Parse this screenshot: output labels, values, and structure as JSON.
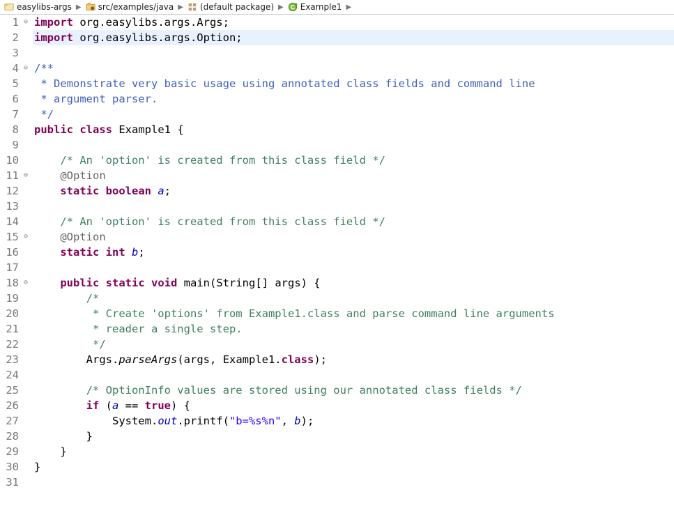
{
  "breadcrumb": {
    "project": "easylibs-args",
    "source_folder": "src/examples/java",
    "package": "(default package)",
    "class": "Example1"
  },
  "code": {
    "lines": [
      {
        "n": 1,
        "fold": "-",
        "tokens": [
          [
            "kw",
            "import"
          ],
          [
            "plain",
            " org.easylibs.args.Args;"
          ]
        ]
      },
      {
        "n": 2,
        "fold": "",
        "hl": true,
        "tokens": [
          [
            "kw",
            "import"
          ],
          [
            "plain",
            " org.easylibs.args.Option;"
          ]
        ]
      },
      {
        "n": 3,
        "fold": "",
        "tokens": []
      },
      {
        "n": 4,
        "fold": "-",
        "tokens": [
          [
            "javadoc",
            "/**"
          ]
        ]
      },
      {
        "n": 5,
        "fold": "",
        "tokens": [
          [
            "javadoc",
            " * Demonstrate very basic usage using annotated class fields and command line"
          ]
        ]
      },
      {
        "n": 6,
        "fold": "",
        "tokens": [
          [
            "javadoc",
            " * argument parser."
          ]
        ]
      },
      {
        "n": 7,
        "fold": "",
        "tokens": [
          [
            "javadoc",
            " */"
          ]
        ]
      },
      {
        "n": 8,
        "fold": "",
        "tokens": [
          [
            "kw",
            "public"
          ],
          [
            "plain",
            " "
          ],
          [
            "kw",
            "class"
          ],
          [
            "plain",
            " Example1 {"
          ]
        ]
      },
      {
        "n": 9,
        "fold": "",
        "tokens": []
      },
      {
        "n": 10,
        "fold": "",
        "tokens": [
          [
            "plain",
            "    "
          ],
          [
            "comment",
            "/* An 'option' is created from this class field */"
          ]
        ]
      },
      {
        "n": 11,
        "fold": "-",
        "tokens": [
          [
            "plain",
            "    "
          ],
          [
            "ann",
            "@Option"
          ]
        ]
      },
      {
        "n": 12,
        "fold": "",
        "tokens": [
          [
            "plain",
            "    "
          ],
          [
            "kw",
            "static"
          ],
          [
            "plain",
            " "
          ],
          [
            "kw",
            "boolean"
          ],
          [
            "plain",
            " "
          ],
          [
            "field",
            "a"
          ],
          [
            "plain",
            ";"
          ]
        ]
      },
      {
        "n": 13,
        "fold": "",
        "tokens": []
      },
      {
        "n": 14,
        "fold": "",
        "tokens": [
          [
            "plain",
            "    "
          ],
          [
            "comment",
            "/* An 'option' is created from this class field */"
          ]
        ]
      },
      {
        "n": 15,
        "fold": "-",
        "tokens": [
          [
            "plain",
            "    "
          ],
          [
            "ann",
            "@Option"
          ]
        ]
      },
      {
        "n": 16,
        "fold": "",
        "tokens": [
          [
            "plain",
            "    "
          ],
          [
            "kw",
            "static"
          ],
          [
            "plain",
            " "
          ],
          [
            "kw",
            "int"
          ],
          [
            "plain",
            " "
          ],
          [
            "field",
            "b"
          ],
          [
            "plain",
            ";"
          ]
        ]
      },
      {
        "n": 17,
        "fold": "",
        "tokens": []
      },
      {
        "n": 18,
        "fold": "-",
        "tokens": [
          [
            "plain",
            "    "
          ],
          [
            "kw",
            "public"
          ],
          [
            "plain",
            " "
          ],
          [
            "kw",
            "static"
          ],
          [
            "plain",
            " "
          ],
          [
            "kw",
            "void"
          ],
          [
            "plain",
            " main(String[] args) {"
          ]
        ]
      },
      {
        "n": 19,
        "fold": "",
        "tokens": [
          [
            "plain",
            "        "
          ],
          [
            "comment",
            "/*"
          ]
        ]
      },
      {
        "n": 20,
        "fold": "",
        "tokens": [
          [
            "plain",
            "        "
          ],
          [
            "comment",
            " * Create 'options' from Example1.class and parse command line arguments"
          ]
        ]
      },
      {
        "n": 21,
        "fold": "",
        "tokens": [
          [
            "plain",
            "        "
          ],
          [
            "comment",
            " * reader a single step."
          ]
        ]
      },
      {
        "n": 22,
        "fold": "",
        "tokens": [
          [
            "plain",
            "        "
          ],
          [
            "comment",
            " */"
          ]
        ]
      },
      {
        "n": 23,
        "fold": "",
        "tokens": [
          [
            "plain",
            "        Args."
          ],
          [
            "static-call",
            "parseArgs"
          ],
          [
            "plain",
            "(args, Example1."
          ],
          [
            "kw",
            "class"
          ],
          [
            "plain",
            ");"
          ]
        ]
      },
      {
        "n": 24,
        "fold": "",
        "tokens": []
      },
      {
        "n": 25,
        "fold": "",
        "tokens": [
          [
            "plain",
            "        "
          ],
          [
            "comment",
            "/* OptionInfo values are stored using our annotated class fields */"
          ]
        ]
      },
      {
        "n": 26,
        "fold": "",
        "tokens": [
          [
            "plain",
            "        "
          ],
          [
            "kw",
            "if"
          ],
          [
            "plain",
            " ("
          ],
          [
            "field",
            "a"
          ],
          [
            "plain",
            " == "
          ],
          [
            "kw",
            "true"
          ],
          [
            "plain",
            ") {"
          ]
        ]
      },
      {
        "n": 27,
        "fold": "",
        "tokens": [
          [
            "plain",
            "            System."
          ],
          [
            "field",
            "out"
          ],
          [
            "plain",
            ".printf("
          ],
          [
            "str",
            "\"b=%s%n\""
          ],
          [
            "plain",
            ", "
          ],
          [
            "field",
            "b"
          ],
          [
            "plain",
            ");"
          ]
        ]
      },
      {
        "n": 28,
        "fold": "",
        "tokens": [
          [
            "plain",
            "        }"
          ]
        ]
      },
      {
        "n": 29,
        "fold": "",
        "tokens": [
          [
            "plain",
            "    }"
          ]
        ]
      },
      {
        "n": 30,
        "fold": "",
        "tokens": [
          [
            "plain",
            "}"
          ]
        ]
      },
      {
        "n": 31,
        "fold": "",
        "tokens": []
      }
    ]
  }
}
